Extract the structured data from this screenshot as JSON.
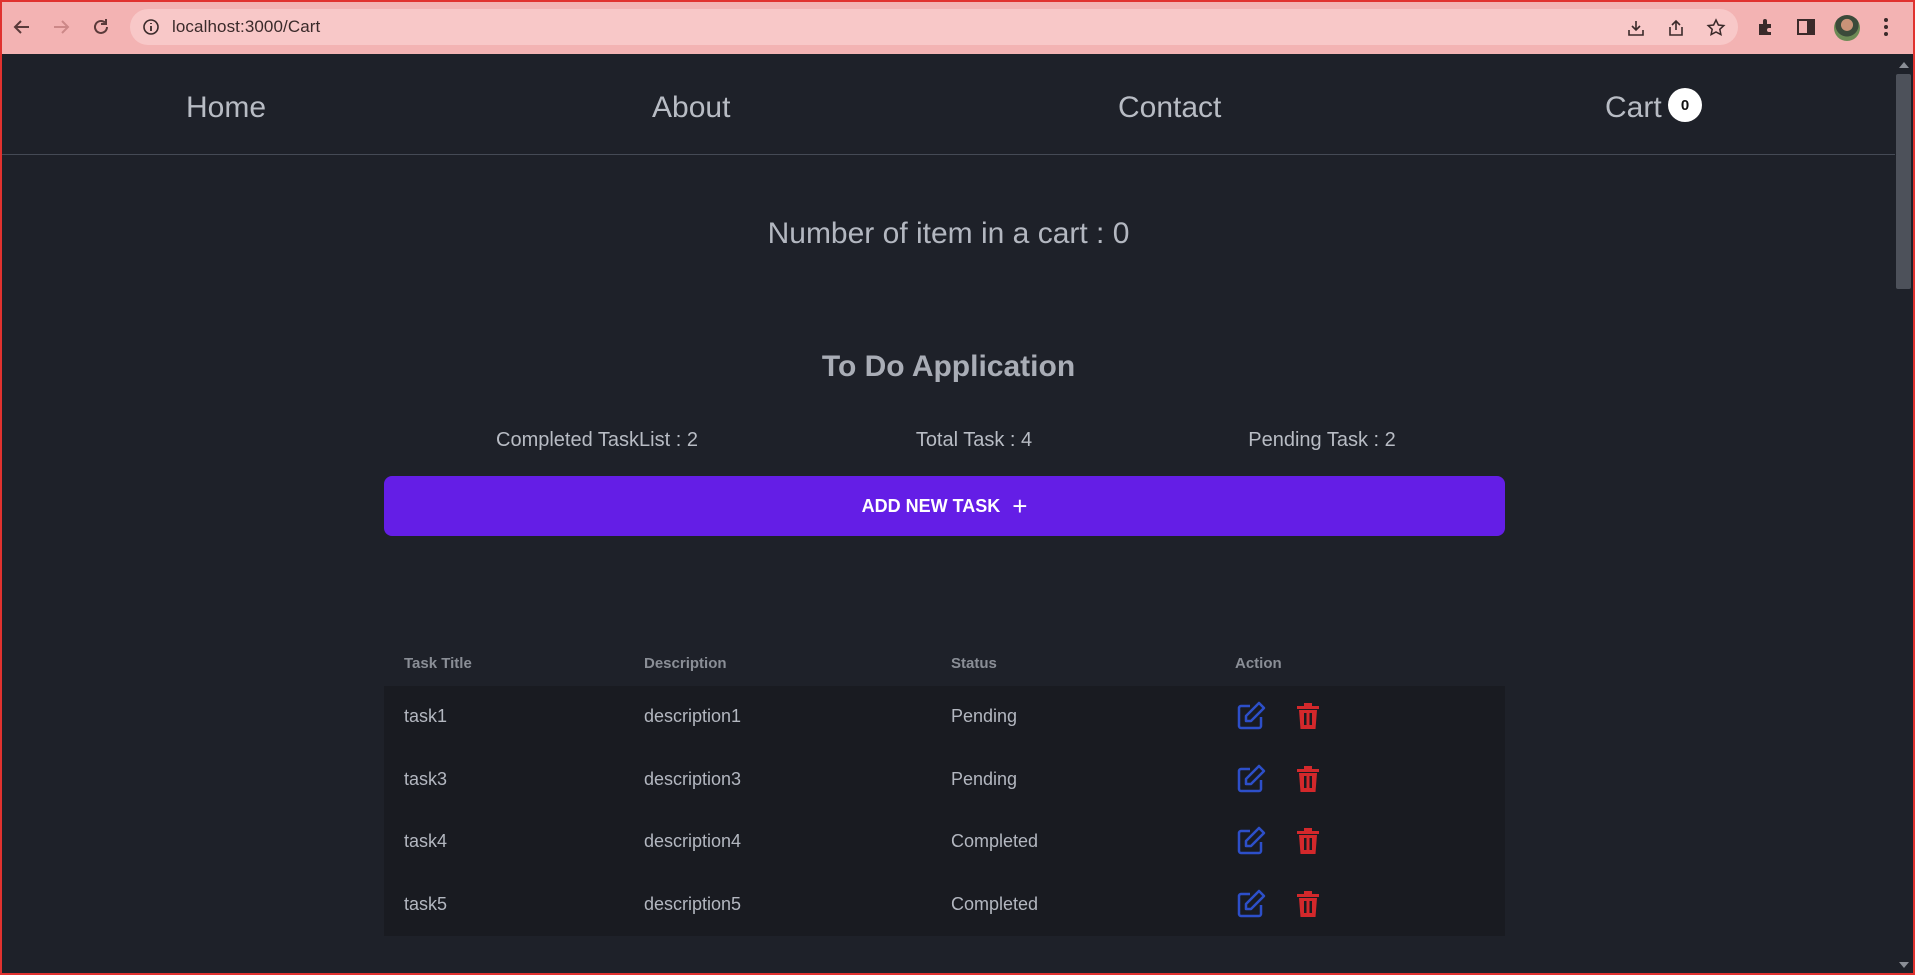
{
  "browser": {
    "url": "localhost:3000/Cart"
  },
  "nav": {
    "home": "Home",
    "about": "About",
    "contact": "Contact",
    "cart": "Cart",
    "cart_badge": "0"
  },
  "cart_summary": "Number of item in a cart : 0",
  "todo": {
    "title": "To Do Application",
    "stats": {
      "completed": "Completed TaskList : 2",
      "total": "Total Task : 4",
      "pending": "Pending Task : 2"
    },
    "add_button": "ADD NEW TASK",
    "add_icon": "+",
    "headers": [
      "Task Title",
      "Description",
      "Status",
      "Action"
    ],
    "rows": [
      {
        "title": "task1",
        "description": "description1",
        "status": "Pending"
      },
      {
        "title": "task3",
        "description": "description3",
        "status": "Pending"
      },
      {
        "title": "task4",
        "description": "description4",
        "status": "Completed"
      },
      {
        "title": "task5",
        "description": "description5",
        "status": "Completed"
      }
    ]
  },
  "icons": {
    "edit": "edit-icon",
    "delete": "trash-icon"
  },
  "colors": {
    "accent": "#641ee6",
    "edit": "#2d4fc9",
    "delete": "#d3282b",
    "background": "#1e2129"
  }
}
